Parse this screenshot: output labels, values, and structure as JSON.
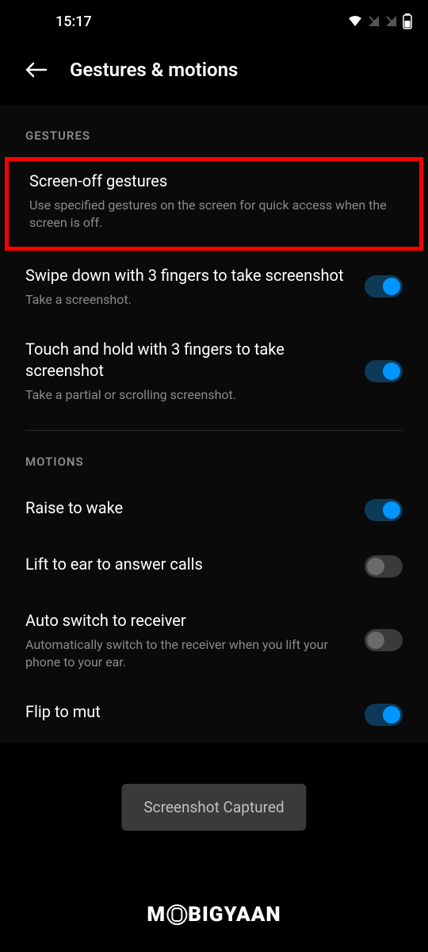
{
  "status_bar": {
    "time": "15:17"
  },
  "header": {
    "title": "Gestures & motions"
  },
  "sections": {
    "gestures": {
      "label": "GESTURES",
      "items": [
        {
          "title": "Screen-off gestures",
          "subtitle": "Use specified gestures on the screen for quick access when the screen is off."
        },
        {
          "title": "Swipe down with 3 fingers to take screenshot",
          "subtitle": "Take a screenshot."
        },
        {
          "title": "Touch and hold with 3 fingers to take screenshot",
          "subtitle": "Take a partial or scrolling screenshot."
        }
      ]
    },
    "motions": {
      "label": "MOTIONS",
      "items": [
        {
          "title": "Raise to wake"
        },
        {
          "title": "Lift to ear to answer calls"
        },
        {
          "title": "Auto switch to receiver",
          "subtitle": "Automatically switch to the receiver when you lift your phone to your ear."
        },
        {
          "title": "Flip to mut"
        }
      ]
    }
  },
  "toast": {
    "message": "Screenshot Captured"
  },
  "watermark": {
    "prefix": "M",
    "suffix": "BIGYAAN"
  }
}
